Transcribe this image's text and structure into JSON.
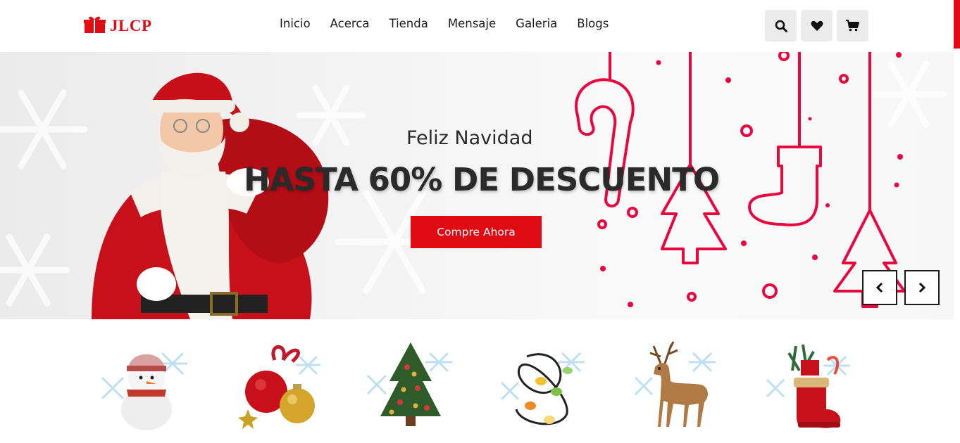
{
  "brand": {
    "name": "JLCP",
    "icon": "gift-icon",
    "color": "#e10b14"
  },
  "nav": {
    "items": [
      {
        "label": "Inicio"
      },
      {
        "label": "Acerca"
      },
      {
        "label": "Tienda"
      },
      {
        "label": "Mensaje"
      },
      {
        "label": "Galeria"
      },
      {
        "label": "Blogs"
      }
    ]
  },
  "actions": [
    {
      "icon": "search-icon"
    },
    {
      "icon": "heart-icon"
    },
    {
      "icon": "cart-icon"
    }
  ],
  "hero": {
    "subtitle": "Feliz Navidad",
    "title": "HASTA 60% DE DESCUENTO",
    "cta_label": "Compre Ahora",
    "accent_color": "#e00a12",
    "prev_icon": "chevron-left-icon",
    "next_icon": "chevron-right-icon"
  },
  "categories": [
    {
      "icon": "snowman-icon"
    },
    {
      "icon": "ornaments-icon"
    },
    {
      "icon": "christmas-tree-icon"
    },
    {
      "icon": "string-lights-icon"
    },
    {
      "icon": "reindeer-icon"
    },
    {
      "icon": "gift-stocking-icon"
    }
  ]
}
